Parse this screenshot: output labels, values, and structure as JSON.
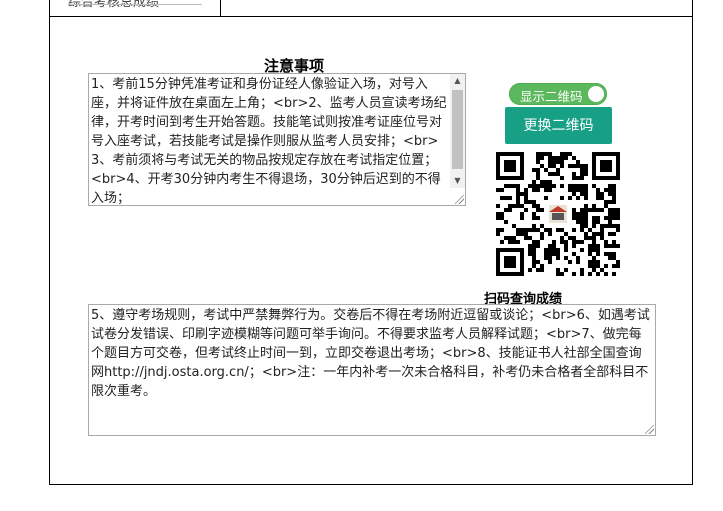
{
  "header": {
    "cut_off_text": "综合考核总成绩"
  },
  "notice": {
    "title": "注意事项",
    "part1": "1、考前15分钟凭准考证和身份证经人像验证入场，对号入座，并将证件放在桌面左上角；<br>2、监考人员宣读考场纪律，开考时间到考生开始答题。技能笔试则按准考证座位号对号入座考试，若技能考试是操作则服从监考人员安排；<br>3、考前须将与考试无关的物品按规定存放在考试指定位置；<br>4、开考30分钟内考生不得退场，30分钟后迟到的不得入场；",
    "part2": "5、遵守考场规则，考试中严禁舞弊行为。交卷后不得在考场附近逗留或谈论；<br>6、如遇考试试卷分发错误、印刷字迹模糊等问题可举手询问。不得要求监考人员解释试题；<br>7、做完每个题目方可交卷，但考试终止时间一到，立即交卷退出考场；<br>8、技能证书人社部全国查询网http://jndj.osta.org.cn/；<br>注：一年内补考一次未合格科目，补考仍未合格者全部科目不限次重考。"
  },
  "qr_panel": {
    "toggle_label": "显示二维码",
    "toggle_on": true,
    "change_button": "更换二维码",
    "caption": "扫码查询成绩",
    "toggle_color": "#5cb85c",
    "button_color": "#17a086"
  },
  "icons": {
    "scroll_up": "scroll-up-arrow-icon",
    "scroll_down": "scroll-down-arrow-icon",
    "qr": "qr-code-icon"
  }
}
